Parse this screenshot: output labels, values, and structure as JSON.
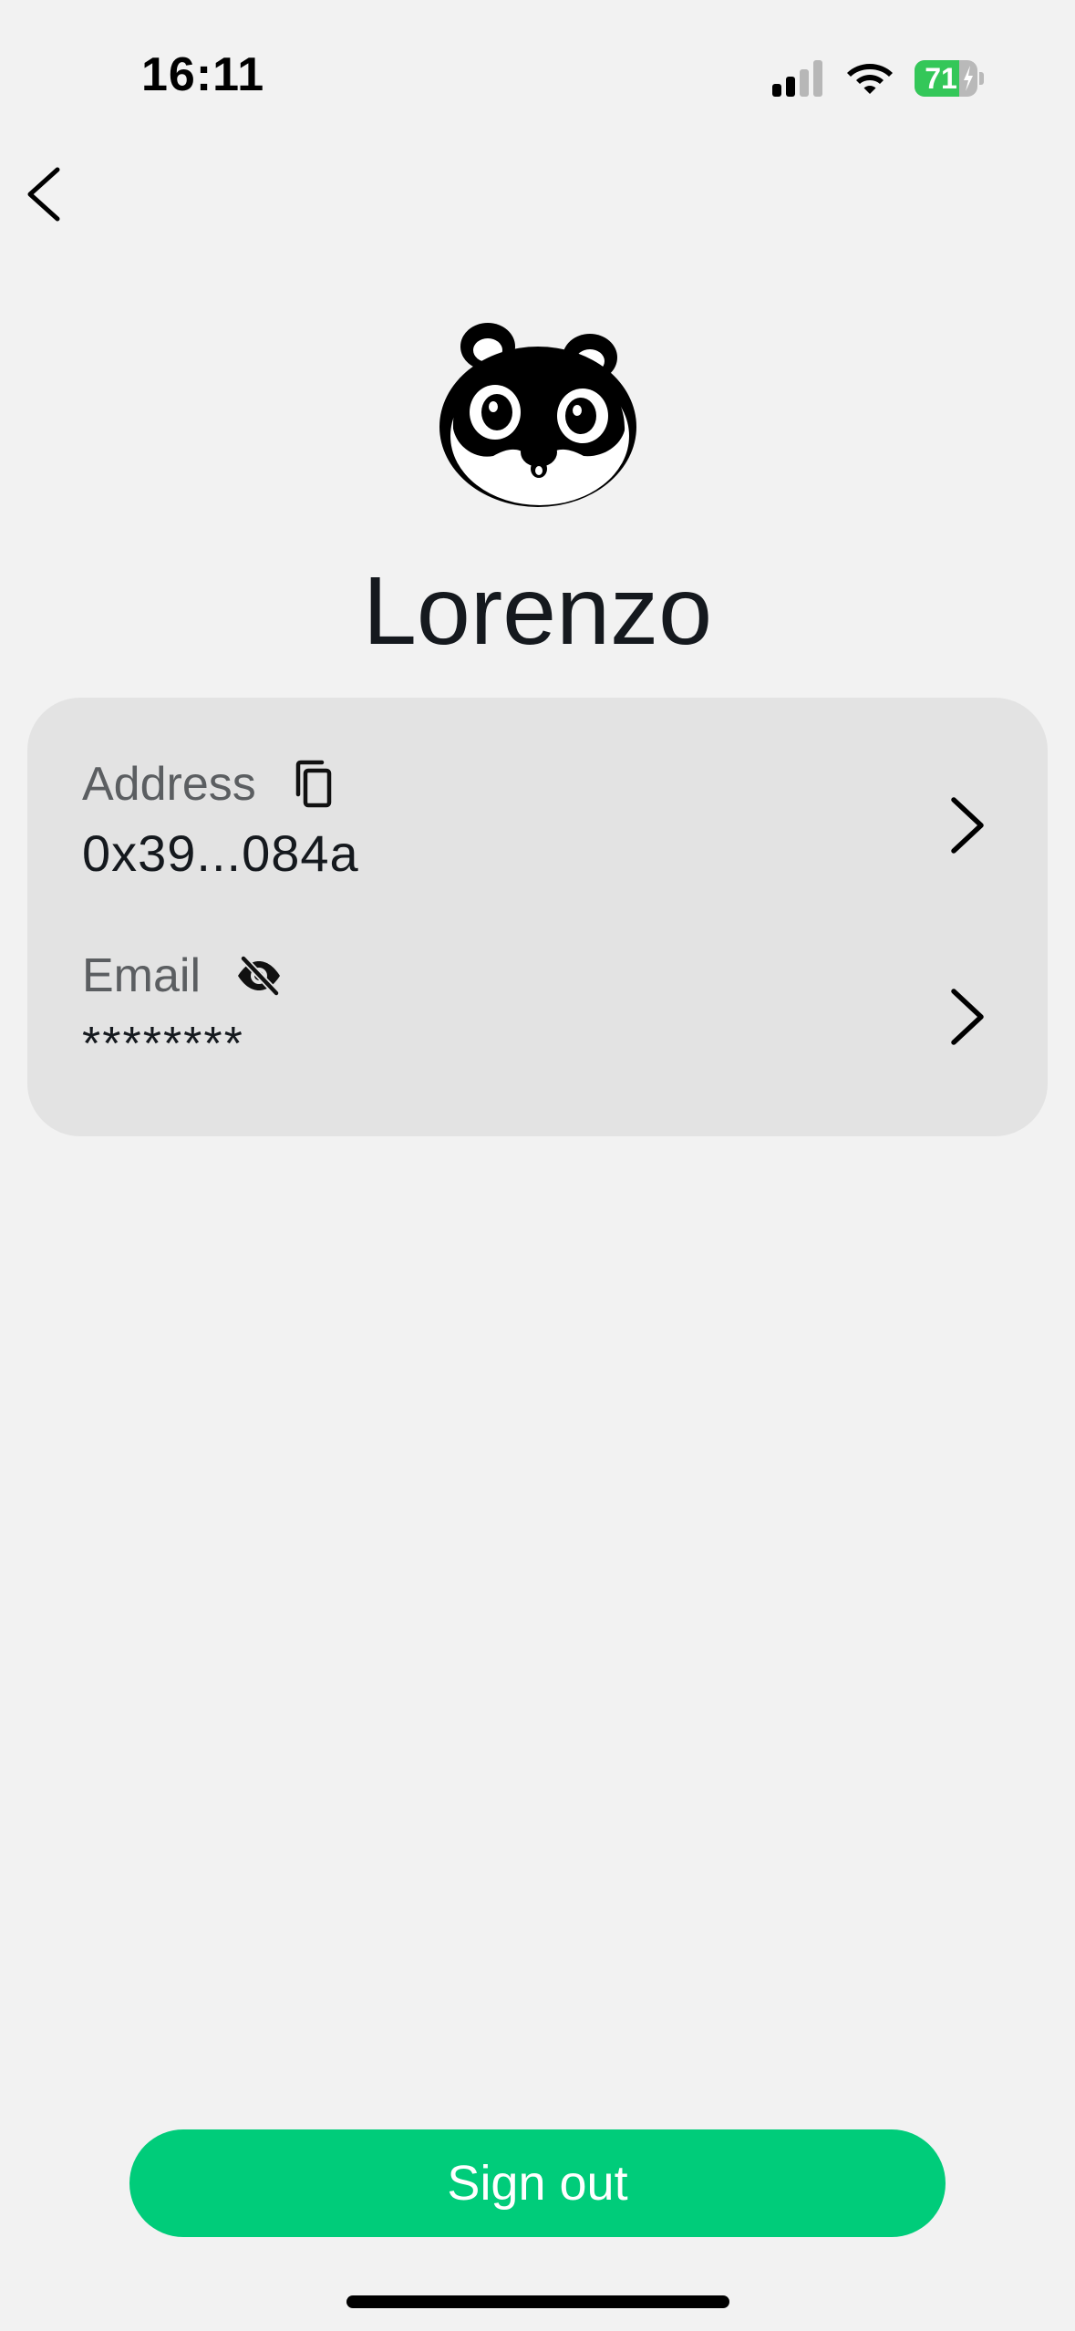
{
  "status_bar": {
    "time": "16:11",
    "battery_level": "71",
    "battery_percent": 71,
    "signal_bars_active": 2,
    "signal_bars_total": 4,
    "icons": [
      "cellular-signal-icon",
      "wifi-icon",
      "battery-charging-icon"
    ],
    "battery_color": "#34c759"
  },
  "nav": {
    "back_icon": "chevron-left-icon"
  },
  "profile": {
    "avatar": "raccoon-avatar",
    "name": "Lorenzo"
  },
  "info_card": {
    "address": {
      "label": "Address",
      "value": "0x39...084a",
      "icon": "copy-icon",
      "action_icon": "chevron-right-icon"
    },
    "email": {
      "label": "Email",
      "value": "********",
      "icon": "eye-off-icon",
      "action_icon": "chevron-right-icon"
    }
  },
  "actions": {
    "sign_out_label": "Sign out"
  },
  "colors": {
    "background": "#f2f2f2",
    "card": "#e3e3e3",
    "accent": "#00cc7a",
    "text_primary": "#15191e",
    "text_secondary": "#5b5e61"
  }
}
